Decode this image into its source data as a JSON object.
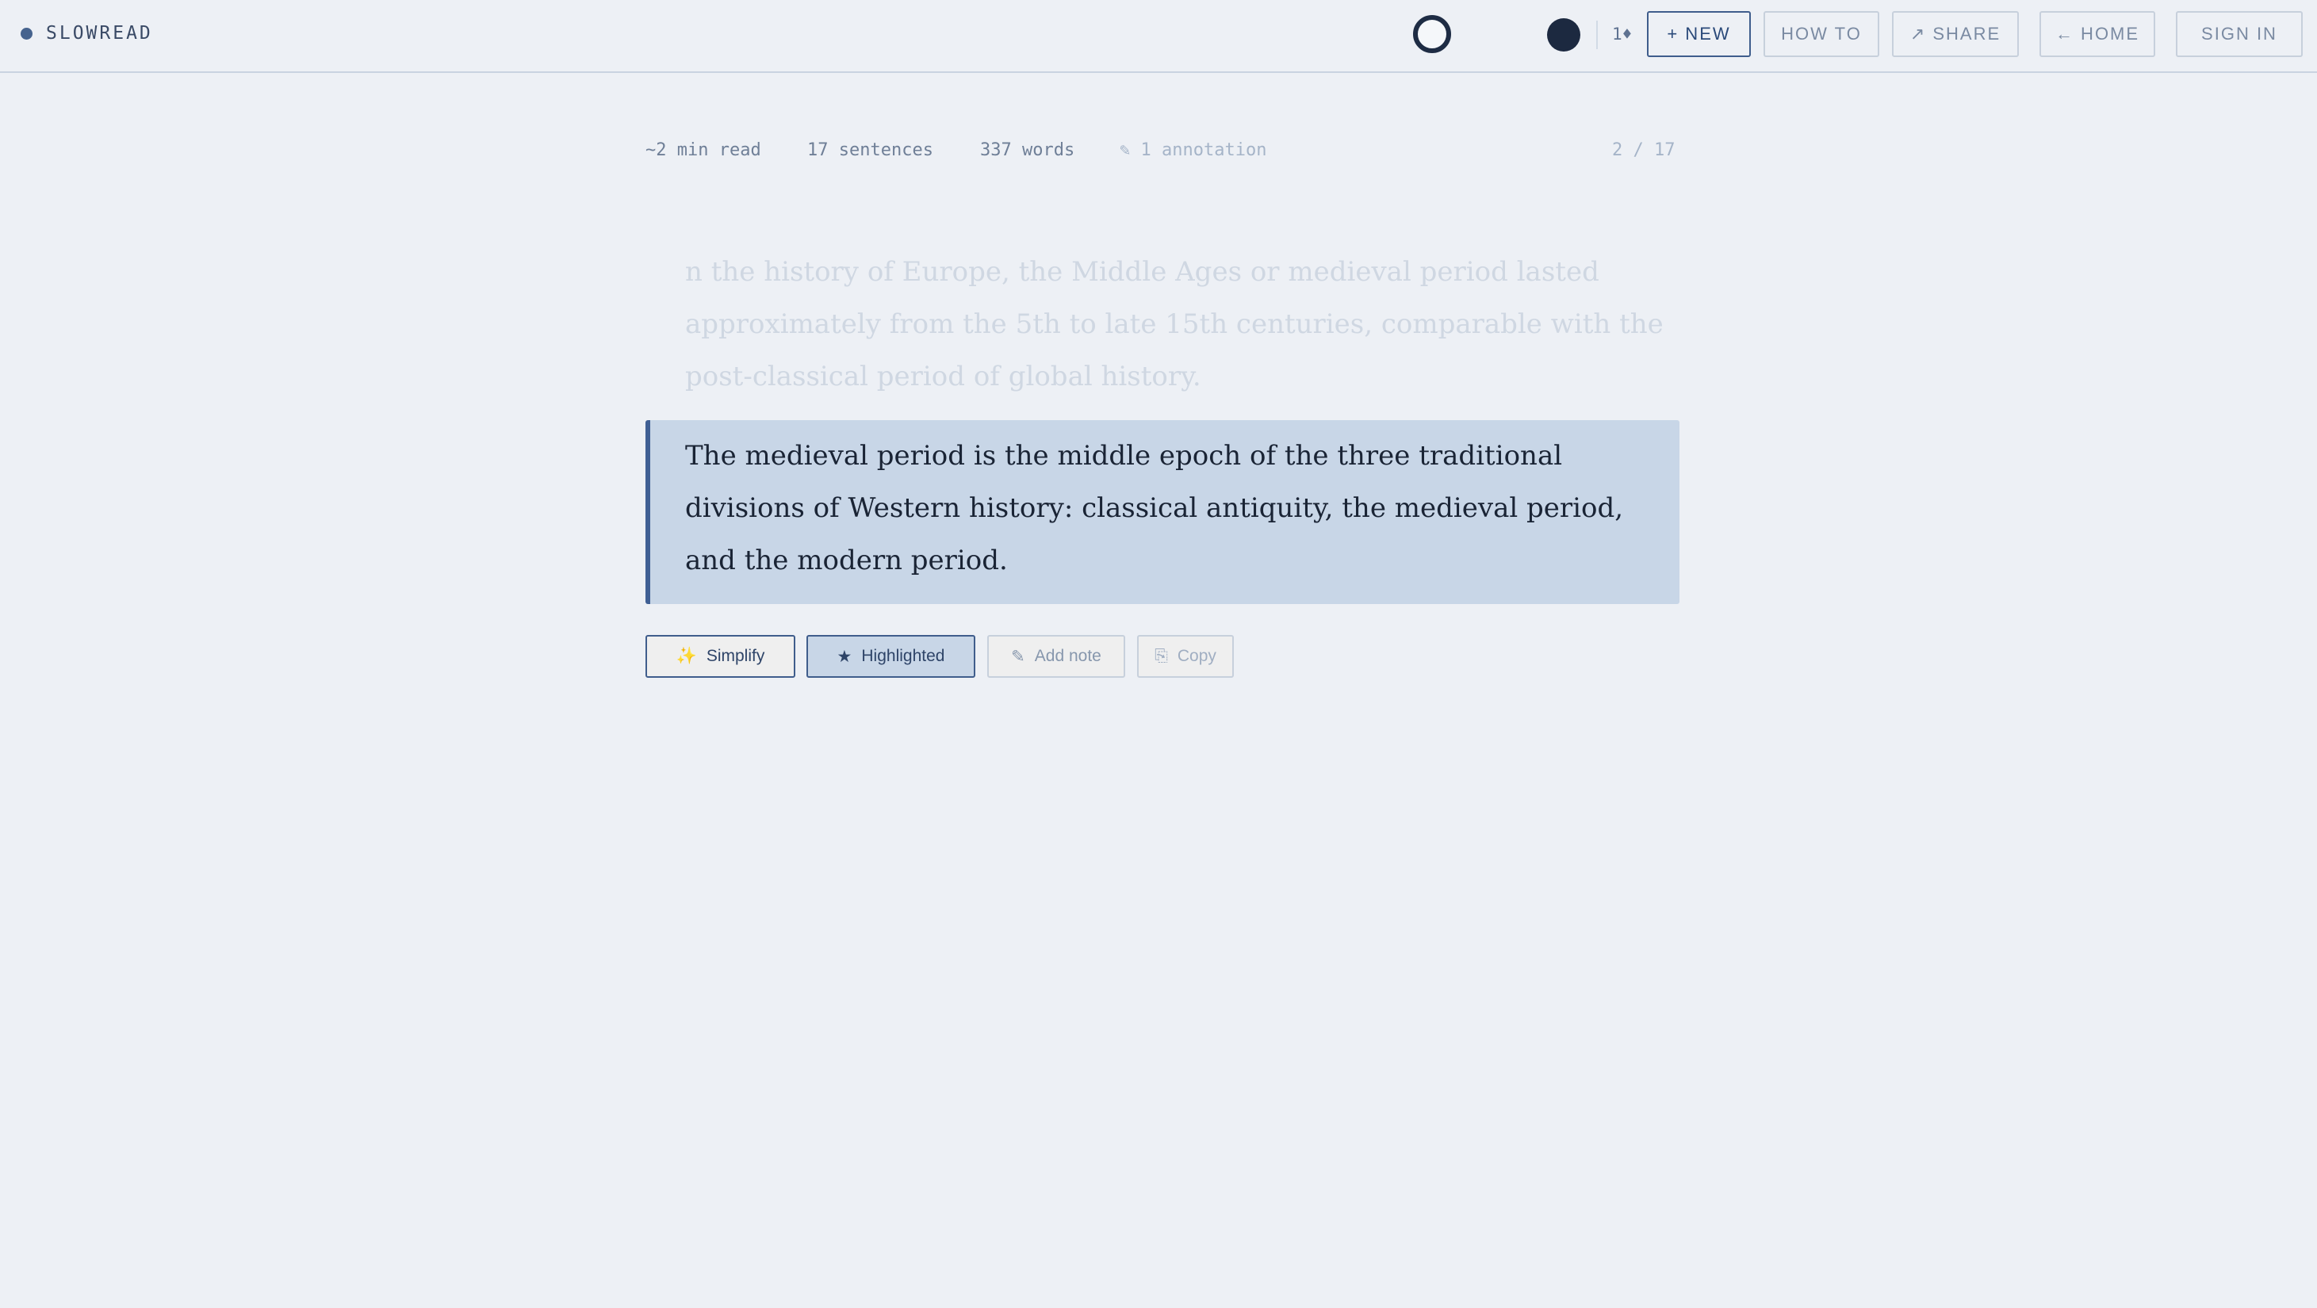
{
  "app": {
    "name": "SLOWREAD"
  },
  "header": {
    "counter": "1♦",
    "buttons": {
      "new": "+ NEW",
      "how_to": "HOW TO",
      "share": "↗ SHARE",
      "home": "← HOME",
      "sign_in": "SIGN IN"
    }
  },
  "stats": {
    "read_time": "~2 min read",
    "sentences": "17 sentences",
    "words": "337 words",
    "annotation_icon": "pencil-icon",
    "annotation_count": "1",
    "annotation_label": "annotation",
    "position": "2 / 17"
  },
  "reader": {
    "previous_sentence": "n the history of Europe, the Middle Ages or medieval period lasted approximately from the 5th to late 15th centuries, comparable with the post-classical period of global history.",
    "current_sentence": "The medieval period is the middle epoch of the three traditional divisions of Western history: classical antiquity, the medieval period, and the modern period."
  },
  "actions": {
    "simplify": {
      "icon": "✨",
      "label": "Simplify"
    },
    "highlighted": {
      "icon": "★",
      "label": "Highlighted"
    },
    "add_note": {
      "icon": "✎",
      "label": "Add note"
    },
    "copy": {
      "icon": "⎘",
      "label": "Copy"
    }
  },
  "colors": {
    "background": "#edf0f5",
    "accent": "#3f5f94",
    "highlight": "#c8d6e7"
  }
}
